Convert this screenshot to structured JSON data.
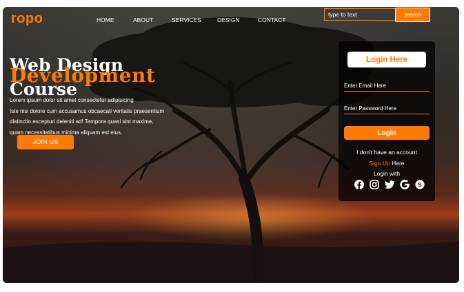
{
  "brand": {
    "logo": "ropo",
    "accent_color": "#ff7a00"
  },
  "nav": {
    "items": [
      "HOME",
      "ABOUT",
      "SERVICES",
      "DESIGN",
      "CONTACT"
    ]
  },
  "search": {
    "placeholder": "type to text",
    "button_label": "search"
  },
  "hero": {
    "line1": "Web Design",
    "line2": "Development",
    "line3": "Course",
    "paragraph": [
      "Lorem ipsum dolor sit amet consectetur adipisicing",
      "Iste nisi dolore cum accusamus obcaecati veritatis praesentium",
      "distinctio excepturi deleniti ad! Tempora quasi sint maxime,",
      "quam necessitatibus minima aliquam est eius."
    ],
    "cta_label": "JOIN US"
  },
  "login": {
    "title": "Login Here",
    "email_placeholder": "Enter Email Here",
    "password_placeholder": "Enter Password Here",
    "button_label": "Login",
    "no_account_text": "I don't have an account",
    "signup_link": "Sign Up",
    "signup_suffix": " Here",
    "login_with": "Login with",
    "social_icons": [
      "facebook-icon",
      "instagram-icon",
      "twitter-icon",
      "google-icon",
      "skype-icon"
    ]
  }
}
